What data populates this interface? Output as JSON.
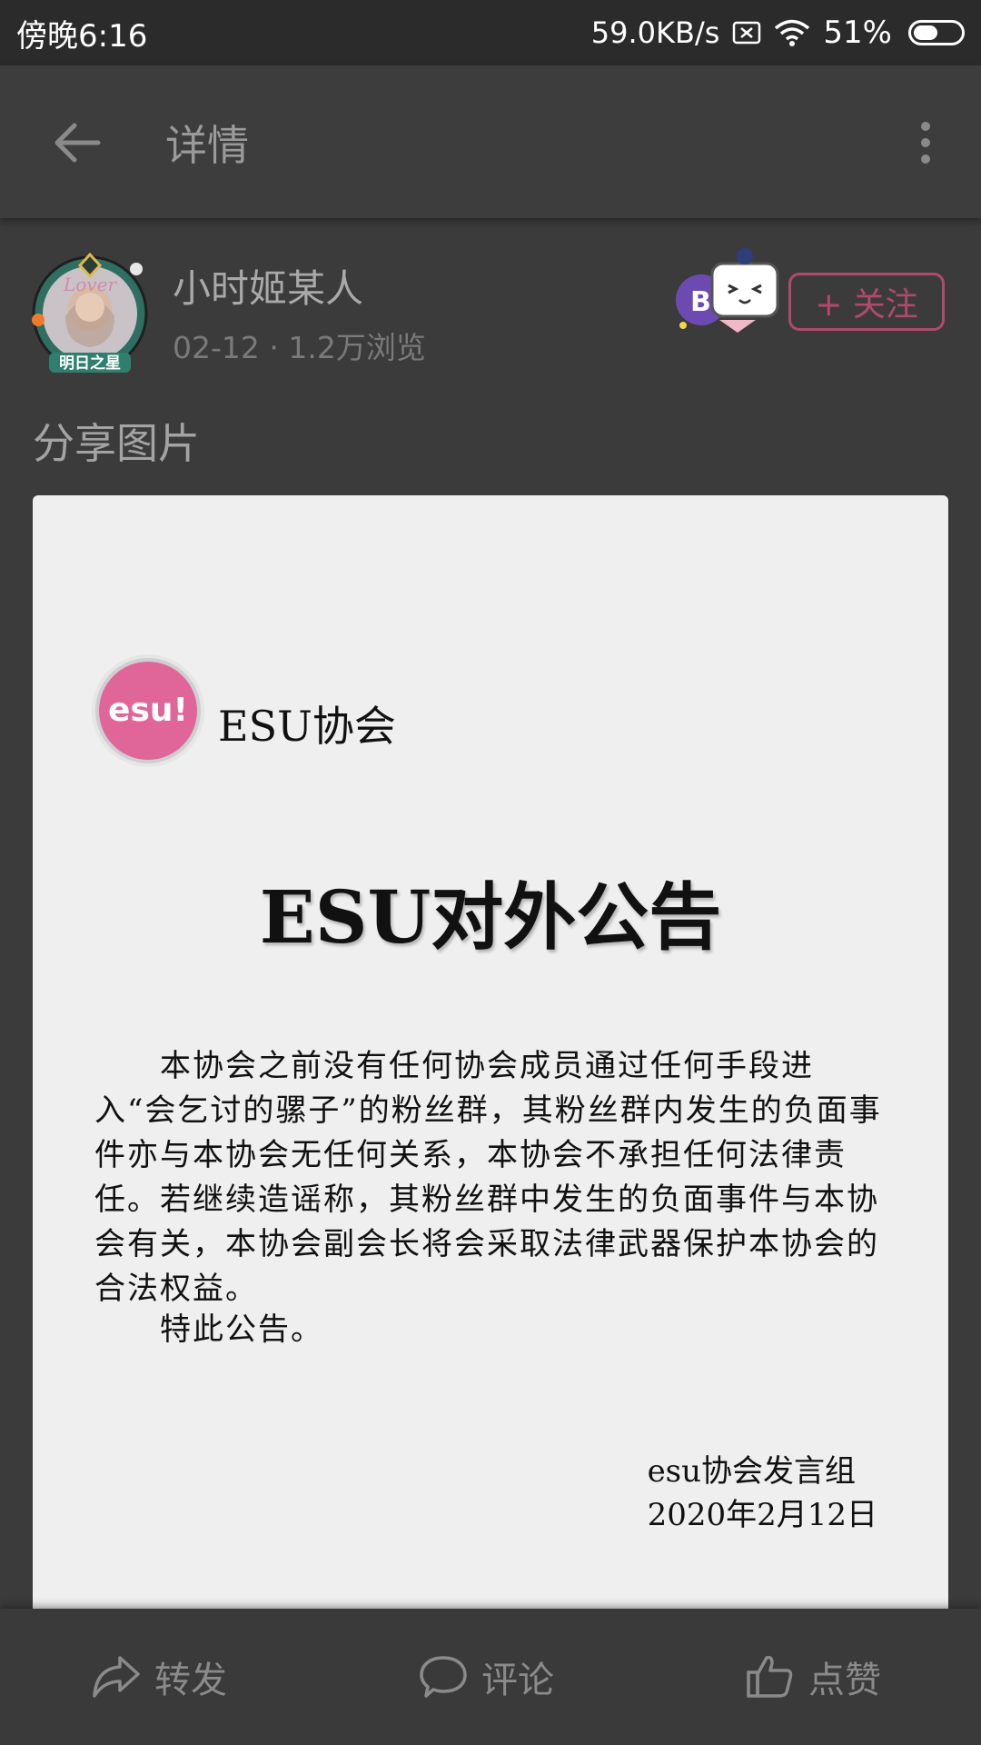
{
  "status_bar": {
    "time": "傍晚6:16",
    "network_speed": "59.0KB/s",
    "battery_percent": "51%",
    "battery_level": 0.51,
    "icons": [
      "sim-off-icon",
      "wifi-icon",
      "battery-icon"
    ]
  },
  "app_bar": {
    "title": "详情",
    "back_icon": "back-arrow-icon",
    "more_icon": "more-vertical-icon"
  },
  "author": {
    "name": "小时姬某人",
    "meta": "02-12 · 1.2万浏览",
    "avatar_badge_text": "明日之星",
    "avatar_frame_text": "Lover",
    "follow_label": "+ 关注"
  },
  "post": {
    "text": "分享图片"
  },
  "shared_image": {
    "logo_text": "esu!",
    "org_name": "ESU协会",
    "title": "ESU对外公告",
    "body": "本协会之前没有任何协会成员通过任何手段进入“会乞讨的骡子”的粉丝群，其粉丝群内发生的负面事件亦与本协会无任何关系，本协会不承担任何法律责任。若继续造谣称，其粉丝群中发生的负面事件与本协会有关，本协会副会长将会采取法律武器保护本协会的合法权益。",
    "closing": "特此公告。",
    "signature_org": "esu协会发言组",
    "signature_date": "2020年2月12日"
  },
  "actions": {
    "share_label": "转发",
    "comment_label": "评论",
    "like_label": "点赞"
  },
  "colors": {
    "background": "#3b3b3b",
    "status_bar": "#2b2b2b",
    "follow_accent": "#b04a6c",
    "logo_pink": "#e0669a"
  }
}
